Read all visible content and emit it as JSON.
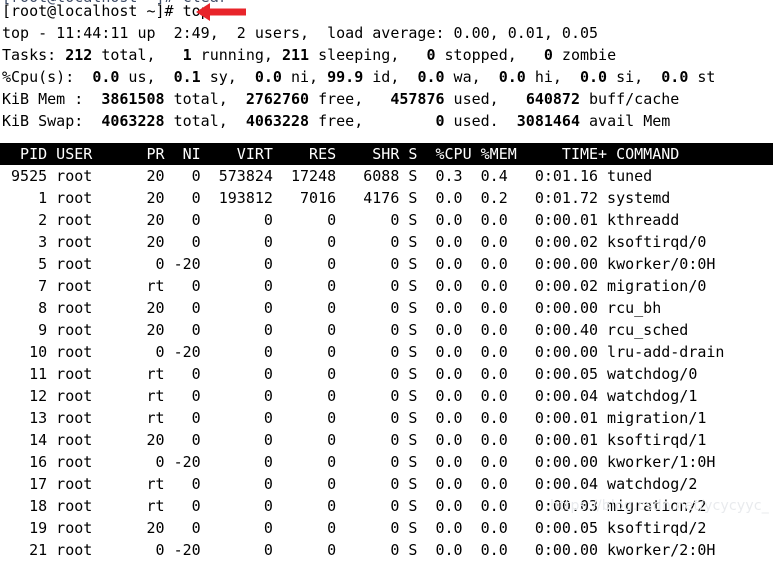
{
  "terminal": {
    "prompt_line": "[root@localhost ~]# top",
    "prompt": "[root@localhost ~]#",
    "command": "top",
    "sliver_text": "[root@localhost ~]# clear"
  },
  "annotation": {
    "arrow_color": "#e8242a",
    "arrow_direction": "left",
    "points_at": "top"
  },
  "summary": {
    "uptime": {
      "prefix": "top - ",
      "time": "11:44:11",
      "up_label": " up ",
      "uptime": " 2:49,",
      "users": "  2 users,",
      "load_label": "  load average: ",
      "load": "0.00, 0.01, 0.05",
      "full": "top - 11:44:11 up  2:49,  2 users,  load average: 0.00, 0.01, 0.05"
    },
    "tasks": {
      "label": "Tasks: ",
      "total": "212",
      "total_label": " total,   ",
      "running": "1",
      "running_label": " running, ",
      "sleeping": "211",
      "sleeping_label": " sleeping,   ",
      "stopped": "0",
      "stopped_label": " stopped,   ",
      "zombie": "0",
      "zombie_label": " zombie"
    },
    "cpu": {
      "label": "%Cpu(s):  ",
      "us": "0.0",
      "us_label": " us,  ",
      "sy": "0.1",
      "sy_label": " sy,  ",
      "ni": "0.0",
      "ni_label": " ni, ",
      "id": "99.9",
      "id_label": " id,  ",
      "wa": "0.0",
      "wa_label": " wa,  ",
      "hi": "0.0",
      "hi_label": " hi,  ",
      "si": "0.0",
      "si_label": " si,  ",
      "st": "0.0",
      "st_label": " st"
    },
    "mem": {
      "label": "KiB Mem :  ",
      "total": "3861508",
      "total_label": " total,  ",
      "free": "2762760",
      "free_label": " free,   ",
      "used": "457876",
      "used_label": " used,   ",
      "buff": "640872",
      "buff_label": " buff/cache"
    },
    "swap": {
      "label": "KiB Swap:  ",
      "total": "4063228",
      "total_label": " total,  ",
      "free": "4063228",
      "free_label": " free,        ",
      "used": "0",
      "used_label": " used.  ",
      "avail": "3081464",
      "avail_label": " avail Mem"
    }
  },
  "table": {
    "columns": [
      "PID",
      "USER",
      "PR",
      "NI",
      "VIRT",
      "RES",
      "SHR",
      "S",
      "%CPU",
      "%MEM",
      "TIME+",
      "COMMAND"
    ],
    "header_line": "  PID USER      PR  NI    VIRT    RES    SHR S  %CPU %MEM     TIME+ COMMAND",
    "rows": [
      {
        "pid": "9525",
        "user": "root",
        "pr": "20",
        "ni": "0",
        "virt": "573824",
        "res": "17248",
        "shr": "6088",
        "s": "S",
        "cpu": "0.3",
        "mem": "0.4",
        "time": "0:01.16",
        "command": "tuned"
      },
      {
        "pid": "1",
        "user": "root",
        "pr": "20",
        "ni": "0",
        "virt": "193812",
        "res": "7016",
        "shr": "4176",
        "s": "S",
        "cpu": "0.0",
        "mem": "0.2",
        "time": "0:01.72",
        "command": "systemd"
      },
      {
        "pid": "2",
        "user": "root",
        "pr": "20",
        "ni": "0",
        "virt": "0",
        "res": "0",
        "shr": "0",
        "s": "S",
        "cpu": "0.0",
        "mem": "0.0",
        "time": "0:00.01",
        "command": "kthreadd"
      },
      {
        "pid": "3",
        "user": "root",
        "pr": "20",
        "ni": "0",
        "virt": "0",
        "res": "0",
        "shr": "0",
        "s": "S",
        "cpu": "0.0",
        "mem": "0.0",
        "time": "0:00.02",
        "command": "ksoftirqd/0"
      },
      {
        "pid": "5",
        "user": "root",
        "pr": "0",
        "ni": "-20",
        "virt": "0",
        "res": "0",
        "shr": "0",
        "s": "S",
        "cpu": "0.0",
        "mem": "0.0",
        "time": "0:00.00",
        "command": "kworker/0:0H"
      },
      {
        "pid": "7",
        "user": "root",
        "pr": "rt",
        "ni": "0",
        "virt": "0",
        "res": "0",
        "shr": "0",
        "s": "S",
        "cpu": "0.0",
        "mem": "0.0",
        "time": "0:00.02",
        "command": "migration/0"
      },
      {
        "pid": "8",
        "user": "root",
        "pr": "20",
        "ni": "0",
        "virt": "0",
        "res": "0",
        "shr": "0",
        "s": "S",
        "cpu": "0.0",
        "mem": "0.0",
        "time": "0:00.00",
        "command": "rcu_bh"
      },
      {
        "pid": "9",
        "user": "root",
        "pr": "20",
        "ni": "0",
        "virt": "0",
        "res": "0",
        "shr": "0",
        "s": "S",
        "cpu": "0.0",
        "mem": "0.0",
        "time": "0:00.40",
        "command": "rcu_sched"
      },
      {
        "pid": "10",
        "user": "root",
        "pr": "0",
        "ni": "-20",
        "virt": "0",
        "res": "0",
        "shr": "0",
        "s": "S",
        "cpu": "0.0",
        "mem": "0.0",
        "time": "0:00.00",
        "command": "lru-add-drain"
      },
      {
        "pid": "11",
        "user": "root",
        "pr": "rt",
        "ni": "0",
        "virt": "0",
        "res": "0",
        "shr": "0",
        "s": "S",
        "cpu": "0.0",
        "mem": "0.0",
        "time": "0:00.05",
        "command": "watchdog/0"
      },
      {
        "pid": "12",
        "user": "root",
        "pr": "rt",
        "ni": "0",
        "virt": "0",
        "res": "0",
        "shr": "0",
        "s": "S",
        "cpu": "0.0",
        "mem": "0.0",
        "time": "0:00.04",
        "command": "watchdog/1"
      },
      {
        "pid": "13",
        "user": "root",
        "pr": "rt",
        "ni": "0",
        "virt": "0",
        "res": "0",
        "shr": "0",
        "s": "S",
        "cpu": "0.0",
        "mem": "0.0",
        "time": "0:00.01",
        "command": "migration/1"
      },
      {
        "pid": "14",
        "user": "root",
        "pr": "20",
        "ni": "0",
        "virt": "0",
        "res": "0",
        "shr": "0",
        "s": "S",
        "cpu": "0.0",
        "mem": "0.0",
        "time": "0:00.01",
        "command": "ksoftirqd/1"
      },
      {
        "pid": "16",
        "user": "root",
        "pr": "0",
        "ni": "-20",
        "virt": "0",
        "res": "0",
        "shr": "0",
        "s": "S",
        "cpu": "0.0",
        "mem": "0.0",
        "time": "0:00.00",
        "command": "kworker/1:0H"
      },
      {
        "pid": "17",
        "user": "root",
        "pr": "rt",
        "ni": "0",
        "virt": "0",
        "res": "0",
        "shr": "0",
        "s": "S",
        "cpu": "0.0",
        "mem": "0.0",
        "time": "0:00.04",
        "command": "watchdog/2"
      },
      {
        "pid": "18",
        "user": "root",
        "pr": "rt",
        "ni": "0",
        "virt": "0",
        "res": "0",
        "shr": "0",
        "s": "S",
        "cpu": "0.0",
        "mem": "0.0",
        "time": "0:00.03",
        "command": "migration/2"
      },
      {
        "pid": "19",
        "user": "root",
        "pr": "20",
        "ni": "0",
        "virt": "0",
        "res": "0",
        "shr": "0",
        "s": "S",
        "cpu": "0.0",
        "mem": "0.0",
        "time": "0:00.05",
        "command": "ksoftirqd/2"
      },
      {
        "pid": "21",
        "user": "root",
        "pr": "0",
        "ni": "-20",
        "virt": "0",
        "res": "0",
        "shr": "0",
        "s": "S",
        "cpu": "0.0",
        "mem": "0.0",
        "time": "0:00.00",
        "command": "kworker/2:0H"
      }
    ]
  },
  "watermark": {
    "text": "https://blog.csdn.net/ycycyyc_"
  }
}
